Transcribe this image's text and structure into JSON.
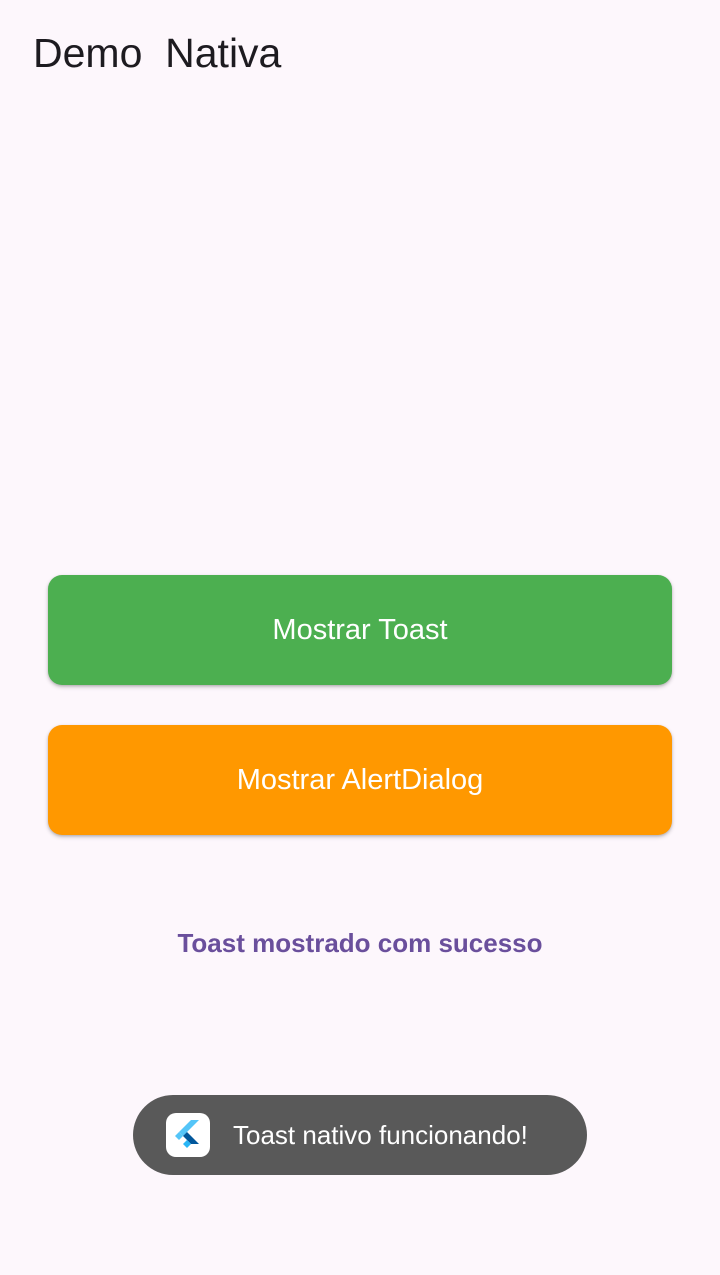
{
  "app": {
    "title": "Demo  Nativa"
  },
  "buttons": {
    "toast_label": "Mostrar Toast",
    "alert_label": "Mostrar AlertDialog"
  },
  "status": {
    "message": "Toast mostrado com sucesso"
  },
  "toast": {
    "icon": "flutter-logo-icon",
    "message": "Toast nativo funcionando!"
  },
  "colors": {
    "background": "#fdf7fc",
    "toast_button": "#4caf50",
    "alert_button": "#ff9800",
    "status_text": "#6a4f9c",
    "toast_background": "#595959"
  }
}
